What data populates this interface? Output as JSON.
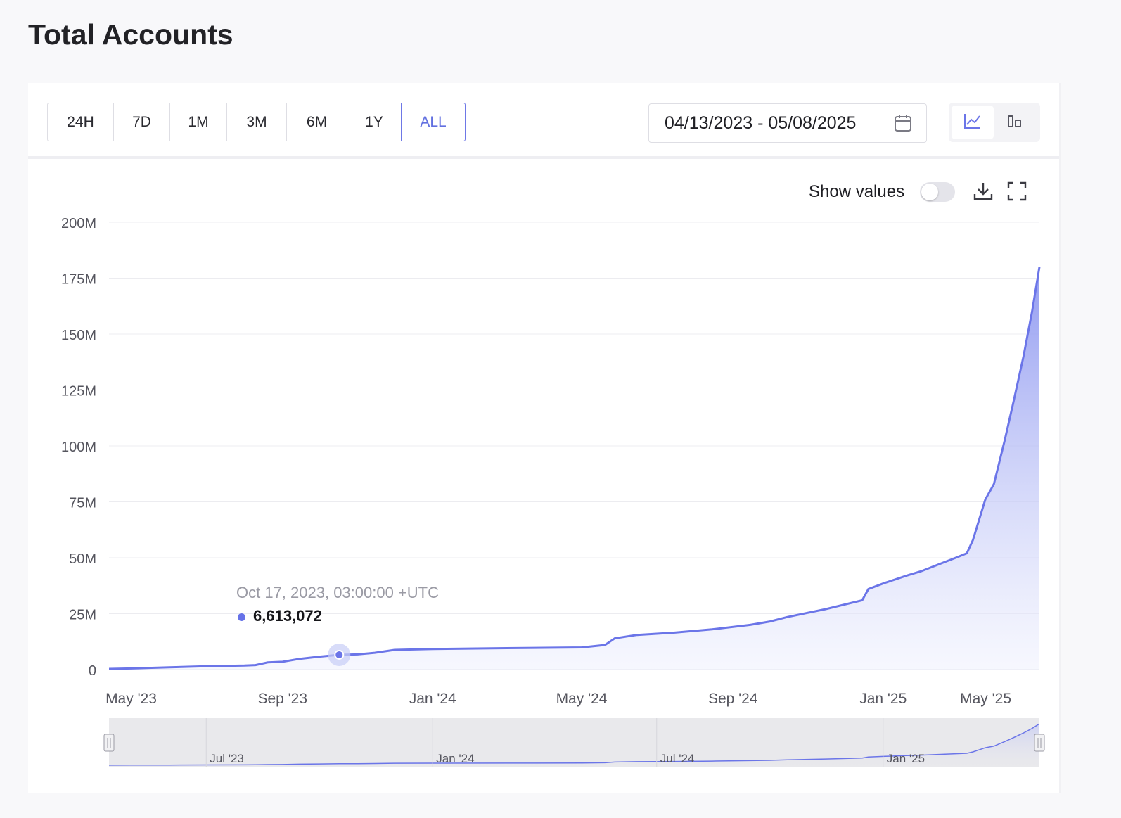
{
  "page": {
    "title": "Total Accounts"
  },
  "range_buttons": [
    {
      "label": "24H",
      "active": false
    },
    {
      "label": "7D",
      "active": false
    },
    {
      "label": "1M",
      "active": false
    },
    {
      "label": "3M",
      "active": false
    },
    {
      "label": "6M",
      "active": false
    },
    {
      "label": "1Y",
      "active": false
    },
    {
      "label": "ALL",
      "active": true
    }
  ],
  "date_range": {
    "value": "04/13/2023 - 05/08/2025",
    "icon": "calendar-icon"
  },
  "view_toggle": {
    "options": [
      "line-chart-icon",
      "bar-chart-icon"
    ],
    "active": "line-chart-icon"
  },
  "controls": {
    "show_values_label": "Show values",
    "show_values_on": false,
    "download_icon": "download-icon",
    "fullscreen_icon": "fullscreen-icon"
  },
  "tooltip": {
    "date": "Oct 17, 2023, 03:00:00 +UTC",
    "value": "6,613,072",
    "x": "2023-10-17",
    "y": 6613072
  },
  "colors": {
    "accent": "#6b75e8",
    "fill_top": "#8c96f0",
    "grid": "#ececf0",
    "navigator_bg": "#e9e9ec"
  },
  "chart_data": {
    "type": "area",
    "title": "",
    "xlabel": "",
    "ylabel": "",
    "x_range": [
      "2023-04-13",
      "2025-05-08"
    ],
    "ylim": [
      0,
      200000000
    ],
    "y_ticks": [
      {
        "value": 0,
        "label": "0"
      },
      {
        "value": 25000000,
        "label": "25M"
      },
      {
        "value": 50000000,
        "label": "50M"
      },
      {
        "value": 75000000,
        "label": "75M"
      },
      {
        "value": 100000000,
        "label": "100M"
      },
      {
        "value": 125000000,
        "label": "125M"
      },
      {
        "value": 150000000,
        "label": "150M"
      },
      {
        "value": 175000000,
        "label": "175M"
      },
      {
        "value": 200000000,
        "label": "200M"
      }
    ],
    "x_ticks": [
      {
        "date": "2023-05-01",
        "label": "May '23"
      },
      {
        "date": "2023-09-01",
        "label": "Sep '23"
      },
      {
        "date": "2024-01-01",
        "label": "Jan '24"
      },
      {
        "date": "2024-05-01",
        "label": "May '24"
      },
      {
        "date": "2024-09-01",
        "label": "Sep '24"
      },
      {
        "date": "2025-01-01",
        "label": "Jan '25"
      },
      {
        "date": "2025-05-01",
        "label": "May '25"
      }
    ],
    "grid": true,
    "series": [
      {
        "name": "",
        "points": [
          [
            "2023-04-13",
            300000
          ],
          [
            "2023-05-01",
            500000
          ],
          [
            "2023-06-01",
            1000000
          ],
          [
            "2023-07-01",
            1500000
          ],
          [
            "2023-08-01",
            1800000
          ],
          [
            "2023-08-10",
            2000000
          ],
          [
            "2023-08-20",
            3200000
          ],
          [
            "2023-09-01",
            3500000
          ],
          [
            "2023-09-15",
            4800000
          ],
          [
            "2023-10-01",
            5800000
          ],
          [
            "2023-10-17",
            6613072
          ],
          [
            "2023-11-01",
            6800000
          ],
          [
            "2023-11-15",
            7500000
          ],
          [
            "2023-12-01",
            8800000
          ],
          [
            "2024-01-01",
            9200000
          ],
          [
            "2024-03-01",
            9600000
          ],
          [
            "2024-05-01",
            9900000
          ],
          [
            "2024-05-20",
            11000000
          ],
          [
            "2024-05-28",
            14000000
          ],
          [
            "2024-06-15",
            15500000
          ],
          [
            "2024-07-15",
            16500000
          ],
          [
            "2024-08-15",
            18000000
          ],
          [
            "2024-09-15",
            20000000
          ],
          [
            "2024-10-01",
            21500000
          ],
          [
            "2024-10-15",
            23500000
          ],
          [
            "2024-11-15",
            27000000
          ],
          [
            "2024-12-15",
            31000000
          ],
          [
            "2024-12-20",
            36000000
          ],
          [
            "2025-01-01",
            38500000
          ],
          [
            "2025-01-20",
            42000000
          ],
          [
            "2025-02-01",
            44000000
          ],
          [
            "2025-02-15",
            47000000
          ],
          [
            "2025-03-01",
            50000000
          ],
          [
            "2025-03-10",
            52000000
          ],
          [
            "2025-03-15",
            58000000
          ],
          [
            "2025-03-25",
            76000000
          ],
          [
            "2025-04-01",
            83000000
          ],
          [
            "2025-04-10",
            103000000
          ],
          [
            "2025-04-17",
            120000000
          ],
          [
            "2025-04-25",
            140000000
          ],
          [
            "2025-05-02",
            160000000
          ],
          [
            "2025-05-08",
            180000000
          ]
        ]
      }
    ],
    "navigator": {
      "labels": [
        {
          "date": "2023-07-01",
          "label": "Jul '23"
        },
        {
          "date": "2024-01-01",
          "label": "Jan '24"
        },
        {
          "date": "2024-07-01",
          "label": "Jul '24"
        },
        {
          "date": "2025-01-01",
          "label": "Jan '25"
        }
      ]
    },
    "highlight_point": {
      "x": "2023-10-17",
      "y": 6613072
    },
    "legend": "none"
  }
}
